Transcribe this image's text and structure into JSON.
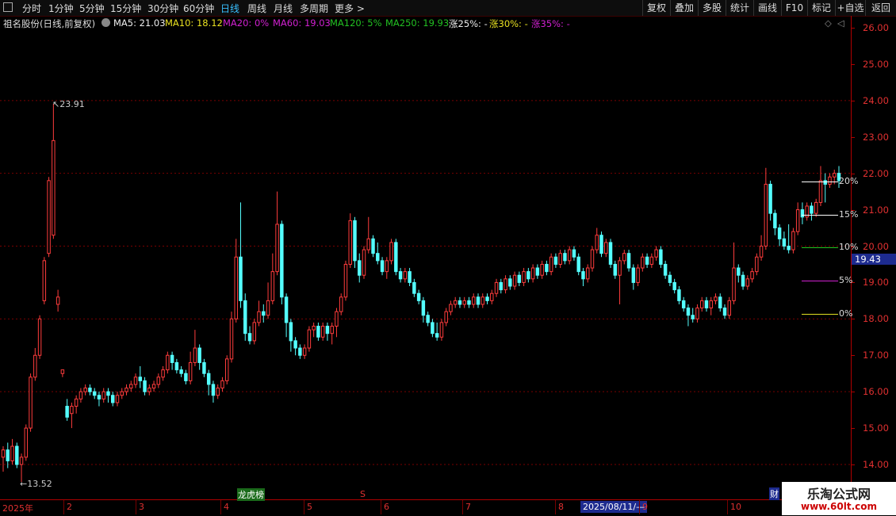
{
  "toolbar": {
    "periods": [
      {
        "label": "分时",
        "active": false
      },
      {
        "label": "1分钟",
        "active": false
      },
      {
        "label": "5分钟",
        "active": false
      },
      {
        "label": "15分钟",
        "active": false
      },
      {
        "label": "30分钟",
        "active": false
      },
      {
        "label": "60分钟",
        "active": false
      },
      {
        "label": "日线",
        "active": true
      },
      {
        "label": "周线",
        "active": false
      },
      {
        "label": "月线",
        "active": false
      },
      {
        "label": "多周期",
        "active": false
      },
      {
        "label": "更多 >",
        "active": false
      }
    ],
    "right_buttons": [
      "复权",
      "叠加",
      "多股",
      "统计",
      "画线",
      "F10",
      "标记",
      "+自选",
      "返回"
    ]
  },
  "info": {
    "title": "祖名股份(日线,前复权)",
    "ma5": "MA5: 21.03",
    "ma10": "MA10: 18.12",
    "ma20": "MA20:  0%",
    "ma60": "MA60: 19.03",
    "ma120": "MA120:  5%",
    "ma250": "MA250: 19.93",
    "z25": "涨25%: -",
    "z30": "涨30%: -",
    "z35": "涨35%: -"
  },
  "y_axis": {
    "labels": [
      "26.00",
      "25.00",
      "24.00",
      "23.00",
      "22.00",
      "21.00",
      "20.00",
      "19.00",
      "18.00",
      "17.00",
      "16.00",
      "15.00",
      "14.00"
    ]
  },
  "price_tag": "19.43",
  "annotations": {
    "high": "23.91",
    "low": "13.52"
  },
  "pct_lines": [
    {
      "label": "20%",
      "color": "#ffffff"
    },
    {
      "label": "15%",
      "color": "#ffffff"
    },
    {
      "label": "10%",
      "color": "#22c022"
    },
    {
      "label": "5%",
      "color": "#d020d0"
    },
    {
      "label": "0%",
      "color": "#e0e020"
    }
  ],
  "markers": {
    "tag_green": "龙虎榜",
    "tag_s": "S",
    "tag_right": "财"
  },
  "months": [
    "2025年",
    "2",
    "3",
    "4",
    "5",
    "6",
    "7",
    "8",
    "9",
    "10"
  ],
  "date_selected": "2025/08/11/—",
  "watermark": {
    "title": "乐淘公式网",
    "url": "www.60lt.com"
  },
  "chart_data": {
    "type": "candlestick",
    "ylim": [
      13.5,
      26.0
    ],
    "y_ticks": [
      26,
      25,
      24,
      23,
      22,
      21,
      20,
      19,
      18,
      17,
      16,
      15,
      14
    ],
    "candles": [
      [
        14.2,
        14.4,
        13.8,
        14.5
      ],
      [
        14.4,
        14.1,
        13.9,
        14.6
      ],
      [
        14.1,
        14.5,
        14.0,
        14.7
      ],
      [
        14.5,
        14.0,
        13.9,
        14.6
      ],
      [
        14.0,
        14.2,
        13.52,
        14.3
      ],
      [
        14.2,
        15.0,
        14.1,
        15.1
      ],
      [
        15.0,
        16.4,
        14.9,
        16.5
      ],
      [
        16.4,
        17.0,
        16.3,
        17.2
      ],
      [
        17.0,
        18.0,
        16.9,
        18.1
      ],
      [
        18.5,
        19.6,
        18.4,
        19.7
      ],
      [
        19.8,
        21.8,
        19.7,
        21.9
      ],
      [
        20.3,
        22.9,
        20.2,
        23.91
      ],
      [
        18.4,
        18.6,
        18.2,
        18.8
      ],
      [
        16.5,
        16.6,
        16.4,
        16.6
      ],
      [
        15.6,
        15.3,
        15.2,
        15.8
      ],
      [
        15.4,
        15.6,
        15.0,
        15.7
      ],
      [
        15.6,
        15.8,
        15.4,
        15.9
      ],
      [
        15.8,
        16.0,
        15.7,
        16.1
      ],
      [
        16.0,
        16.1,
        15.9,
        16.2
      ],
      [
        16.1,
        16.0,
        15.9,
        16.2
      ],
      [
        16.0,
        15.9,
        15.8,
        16.1
      ],
      [
        15.9,
        15.8,
        15.6,
        16.0
      ],
      [
        15.8,
        16.0,
        15.7,
        16.1
      ],
      [
        16.0,
        15.9,
        15.7,
        16.1
      ],
      [
        15.9,
        15.7,
        15.6,
        16.0
      ],
      [
        15.7,
        15.9,
        15.6,
        16.0
      ],
      [
        15.9,
        16.0,
        15.8,
        16.1
      ],
      [
        16.0,
        16.1,
        15.9,
        16.2
      ],
      [
        16.1,
        16.2,
        16.0,
        16.3
      ],
      [
        16.2,
        16.4,
        16.1,
        16.5
      ],
      [
        16.4,
        16.3,
        16.1,
        16.7
      ],
      [
        16.3,
        16.0,
        15.9,
        16.4
      ],
      [
        16.0,
        16.1,
        15.9,
        16.2
      ],
      [
        16.1,
        16.2,
        16.0,
        16.3
      ],
      [
        16.2,
        16.4,
        16.1,
        16.5
      ],
      [
        16.4,
        16.6,
        16.3,
        16.7
      ],
      [
        16.6,
        17.0,
        16.5,
        17.1
      ],
      [
        17.0,
        16.8,
        16.6,
        17.1
      ],
      [
        16.8,
        16.6,
        16.5,
        16.9
      ],
      [
        16.6,
        16.5,
        16.4,
        16.7
      ],
      [
        16.5,
        16.3,
        16.2,
        16.6
      ],
      [
        16.3,
        16.8,
        16.2,
        17.1
      ],
      [
        16.8,
        17.2,
        16.7,
        17.7
      ],
      [
        17.2,
        16.8,
        16.6,
        17.3
      ],
      [
        16.8,
        16.5,
        16.4,
        16.9
      ],
      [
        16.5,
        16.2,
        15.9,
        16.6
      ],
      [
        16.2,
        15.9,
        15.7,
        16.3
      ],
      [
        15.9,
        16.1,
        15.8,
        16.2
      ],
      [
        16.1,
        16.3,
        16.0,
        16.4
      ],
      [
        16.3,
        16.9,
        16.2,
        17.0
      ],
      [
        16.9,
        18.0,
        16.8,
        18.2
      ],
      [
        18.0,
        19.7,
        17.9,
        20.2
      ],
      [
        19.7,
        18.5,
        18.3,
        21.2
      ],
      [
        18.5,
        17.6,
        17.4,
        18.7
      ],
      [
        17.6,
        17.4,
        17.3,
        17.8
      ],
      [
        17.4,
        17.9,
        17.3,
        18.0
      ],
      [
        17.9,
        18.2,
        17.8,
        18.5
      ],
      [
        18.2,
        18.1,
        17.9,
        18.4
      ],
      [
        18.1,
        18.5,
        18.0,
        19.0
      ],
      [
        18.5,
        19.3,
        18.4,
        19.8
      ],
      [
        19.3,
        20.6,
        19.2,
        21.5
      ],
      [
        20.6,
        18.6,
        18.4,
        20.7
      ],
      [
        18.6,
        17.9,
        17.5,
        18.7
      ],
      [
        17.9,
        17.4,
        17.1,
        18.0
      ],
      [
        17.4,
        17.2,
        17.0,
        17.5
      ],
      [
        17.2,
        17.0,
        16.9,
        17.3
      ],
      [
        17.0,
        17.2,
        16.9,
        17.3
      ],
      [
        17.2,
        17.7,
        17.1,
        17.8
      ],
      [
        17.7,
        17.8,
        17.5,
        17.9
      ],
      [
        17.8,
        17.5,
        17.4,
        17.9
      ],
      [
        17.5,
        17.8,
        17.4,
        17.9
      ],
      [
        17.8,
        17.6,
        17.4,
        17.9
      ],
      [
        17.6,
        17.8,
        17.3,
        17.9
      ],
      [
        17.8,
        18.2,
        17.5,
        18.3
      ],
      [
        18.2,
        18.6,
        18.1,
        18.7
      ],
      [
        18.6,
        19.5,
        18.5,
        19.6
      ],
      [
        19.5,
        20.7,
        19.4,
        20.9
      ],
      [
        20.7,
        19.6,
        19.4,
        20.8
      ],
      [
        19.6,
        19.2,
        19.0,
        19.8
      ],
      [
        19.2,
        19.9,
        19.1,
        20.0
      ],
      [
        19.9,
        20.2,
        19.8,
        20.8
      ],
      [
        20.2,
        19.8,
        19.7,
        20.3
      ],
      [
        19.8,
        19.6,
        19.5,
        20.1
      ],
      [
        19.6,
        19.3,
        19.2,
        19.7
      ],
      [
        19.3,
        19.6,
        19.1,
        19.7
      ],
      [
        19.6,
        20.1,
        19.5,
        20.2
      ],
      [
        20.1,
        19.3,
        19.2,
        20.2
      ],
      [
        19.3,
        19.1,
        19.0,
        19.4
      ],
      [
        19.1,
        19.3,
        19.0,
        19.4
      ],
      [
        19.3,
        19.0,
        18.9,
        19.4
      ],
      [
        19.0,
        18.7,
        18.6,
        19.1
      ],
      [
        18.7,
        18.5,
        18.4,
        18.8
      ],
      [
        18.5,
        18.1,
        17.9,
        18.6
      ],
      [
        18.1,
        17.9,
        17.8,
        18.2
      ],
      [
        17.9,
        17.6,
        17.5,
        18.0
      ],
      [
        17.6,
        17.5,
        17.4,
        17.9
      ],
      [
        17.5,
        17.9,
        17.4,
        18.0
      ],
      [
        17.9,
        18.2,
        17.8,
        18.3
      ],
      [
        18.2,
        18.4,
        18.1,
        18.5
      ],
      [
        18.4,
        18.5,
        18.3,
        18.6
      ],
      [
        18.5,
        18.4,
        18.3,
        18.6
      ],
      [
        18.4,
        18.5,
        18.3,
        18.6
      ],
      [
        18.5,
        18.4,
        18.3,
        18.6
      ],
      [
        18.4,
        18.6,
        18.3,
        18.7
      ],
      [
        18.6,
        18.4,
        18.3,
        18.7
      ],
      [
        18.4,
        18.6,
        18.3,
        18.7
      ],
      [
        18.6,
        18.5,
        18.4,
        18.7
      ],
      [
        18.5,
        18.7,
        18.4,
        18.8
      ],
      [
        18.7,
        19.0,
        18.6,
        19.1
      ],
      [
        19.0,
        18.8,
        18.7,
        19.1
      ],
      [
        18.8,
        19.1,
        18.7,
        19.2
      ],
      [
        19.1,
        18.9,
        18.8,
        19.2
      ],
      [
        18.9,
        19.2,
        18.8,
        19.3
      ],
      [
        19.2,
        19.0,
        18.9,
        19.3
      ],
      [
        19.0,
        19.3,
        18.9,
        19.4
      ],
      [
        19.3,
        19.1,
        19.0,
        19.4
      ],
      [
        19.1,
        19.4,
        19.0,
        19.5
      ],
      [
        19.4,
        19.2,
        19.1,
        19.5
      ],
      [
        19.2,
        19.5,
        19.1,
        19.6
      ],
      [
        19.5,
        19.3,
        19.2,
        19.6
      ],
      [
        19.3,
        19.7,
        19.2,
        19.8
      ],
      [
        19.7,
        19.5,
        19.4,
        19.8
      ],
      [
        19.5,
        19.8,
        19.4,
        19.9
      ],
      [
        19.8,
        19.6,
        19.5,
        19.9
      ],
      [
        19.6,
        19.9,
        19.5,
        20.0
      ],
      [
        19.9,
        19.7,
        19.6,
        20.0
      ],
      [
        19.7,
        19.3,
        19.2,
        19.8
      ],
      [
        19.3,
        19.1,
        18.9,
        19.4
      ],
      [
        19.1,
        19.4,
        19.0,
        19.5
      ],
      [
        19.4,
        19.9,
        19.3,
        20.0
      ],
      [
        19.9,
        20.3,
        19.8,
        20.5
      ],
      [
        20.3,
        19.8,
        19.7,
        20.4
      ],
      [
        19.8,
        20.1,
        19.7,
        20.2
      ],
      [
        20.1,
        19.5,
        19.4,
        20.2
      ],
      [
        19.5,
        19.2,
        19.1,
        19.6
      ],
      [
        19.2,
        19.6,
        18.4,
        19.7
      ],
      [
        19.6,
        19.8,
        19.5,
        19.9
      ],
      [
        19.8,
        19.4,
        19.3,
        19.9
      ],
      [
        19.4,
        19.0,
        18.8,
        19.5
      ],
      [
        19.0,
        19.4,
        18.9,
        19.5
      ],
      [
        19.4,
        19.7,
        19.3,
        19.8
      ],
      [
        19.7,
        19.5,
        19.4,
        19.8
      ],
      [
        19.5,
        19.7,
        19.4,
        19.8
      ],
      [
        19.7,
        19.9,
        19.6,
        20.0
      ],
      [
        19.9,
        19.5,
        19.4,
        20.0
      ],
      [
        19.5,
        19.2,
        19.1,
        19.6
      ],
      [
        19.2,
        19.0,
        18.9,
        19.3
      ],
      [
        19.0,
        18.8,
        18.7,
        19.1
      ],
      [
        18.8,
        18.5,
        18.4,
        18.9
      ],
      [
        18.5,
        18.3,
        18.2,
        18.6
      ],
      [
        18.3,
        18.1,
        17.8,
        18.4
      ],
      [
        18.1,
        18.0,
        17.9,
        18.3
      ],
      [
        18.0,
        18.3,
        17.9,
        18.4
      ],
      [
        18.3,
        18.5,
        18.2,
        18.6
      ],
      [
        18.5,
        18.3,
        18.2,
        18.6
      ],
      [
        18.3,
        18.5,
        18.1,
        18.6
      ],
      [
        18.5,
        18.6,
        18.4,
        18.7
      ],
      [
        18.6,
        18.3,
        18.2,
        18.7
      ],
      [
        18.3,
        18.1,
        18.0,
        18.4
      ],
      [
        18.1,
        18.5,
        18.0,
        18.6
      ],
      [
        18.5,
        19.4,
        18.4,
        20.1
      ],
      [
        19.4,
        19.2,
        19.0,
        19.5
      ],
      [
        19.2,
        18.9,
        18.8,
        19.3
      ],
      [
        18.9,
        19.1,
        18.8,
        19.2
      ],
      [
        19.1,
        19.3,
        19.0,
        19.4
      ],
      [
        19.3,
        19.7,
        19.2,
        19.8
      ],
      [
        19.7,
        20.0,
        19.6,
        20.3
      ],
      [
        20.0,
        21.7,
        19.9,
        22.15
      ],
      [
        21.7,
        20.9,
        20.7,
        21.8
      ],
      [
        20.9,
        20.5,
        20.3,
        21.0
      ],
      [
        20.5,
        20.2,
        20.0,
        20.6
      ],
      [
        20.2,
        20.0,
        19.9,
        20.4
      ],
      [
        20.0,
        19.9,
        19.8,
        20.6
      ],
      [
        19.9,
        20.4,
        19.8,
        20.5
      ],
      [
        20.4,
        21.0,
        20.3,
        21.2
      ],
      [
        21.0,
        20.8,
        20.6,
        21.2
      ],
      [
        20.8,
        21.1,
        20.7,
        21.2
      ],
      [
        21.1,
        20.9,
        20.7,
        21.2
      ],
      [
        20.9,
        21.2,
        20.8,
        21.3
      ],
      [
        21.2,
        21.8,
        21.1,
        22.2
      ],
      [
        21.8,
        21.7,
        21.2,
        22.0
      ],
      [
        21.7,
        21.9,
        21.6,
        22.0
      ],
      [
        21.9,
        22.0,
        21.7,
        22.1
      ],
      [
        22.0,
        21.8,
        21.6,
        22.2
      ]
    ]
  }
}
